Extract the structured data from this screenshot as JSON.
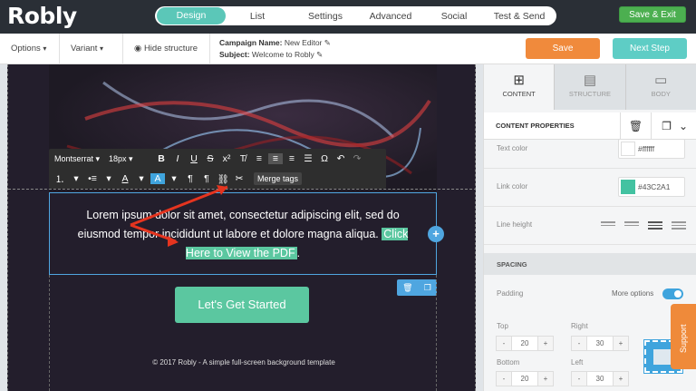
{
  "app": {
    "logo": "Robly"
  },
  "steps": [
    "Design",
    "List",
    "Settings",
    "Advanced",
    "Social",
    "Test & Send"
  ],
  "active_step": "Design",
  "header": {
    "save_exit": "Save & Exit"
  },
  "toolbar": {
    "options": "Options",
    "variant": "Variant",
    "hide_structure": "Hide structure",
    "campaign_label": "Campaign Name:",
    "campaign_value": "New Editor",
    "subject_label": "Subject:",
    "subject_value": "Welcome to Robly",
    "save": "Save",
    "next": "Next Step"
  },
  "editor": {
    "font": "Montserrat",
    "size": "18px",
    "merge_tags": "Merge tags",
    "text_before": "Lorem ipsum dolor sit amet, consectetur adipiscing elit, sed do eiusmod tempor incididunt ut labore et dolore magna aliqua.",
    "link_text": "Click Here to View the PDF",
    "text_after": ".",
    "cta": "Let's Get Started",
    "footer": "© 2017 Robly - A simple full-screen background template"
  },
  "panel": {
    "tabs": [
      {
        "label": "CONTENT",
        "icon": "content-grid-icon"
      },
      {
        "label": "STRUCTURE",
        "icon": "structure-icon"
      },
      {
        "label": "BODY",
        "icon": "body-icon"
      }
    ],
    "section_title": "CONTENT PROPERTIES",
    "text_color_label": "Text color",
    "text_color": "#ffffff",
    "link_color_label": "Link color",
    "link_color": "#43C2A1",
    "line_height_label": "Line height",
    "spacing_title": "SPACING",
    "padding_label": "Padding",
    "more_options": "More options",
    "top_label": "Top",
    "top_value": "20",
    "right_label": "Right",
    "right_value": "30",
    "bottom_label": "Bottom",
    "bottom_value": "20",
    "left_label": "Left",
    "left_value": "30"
  },
  "support": "Support",
  "colors": {
    "accent": "#5bc7a0",
    "orange": "#f08a3c",
    "blue": "#4fa6e0"
  }
}
